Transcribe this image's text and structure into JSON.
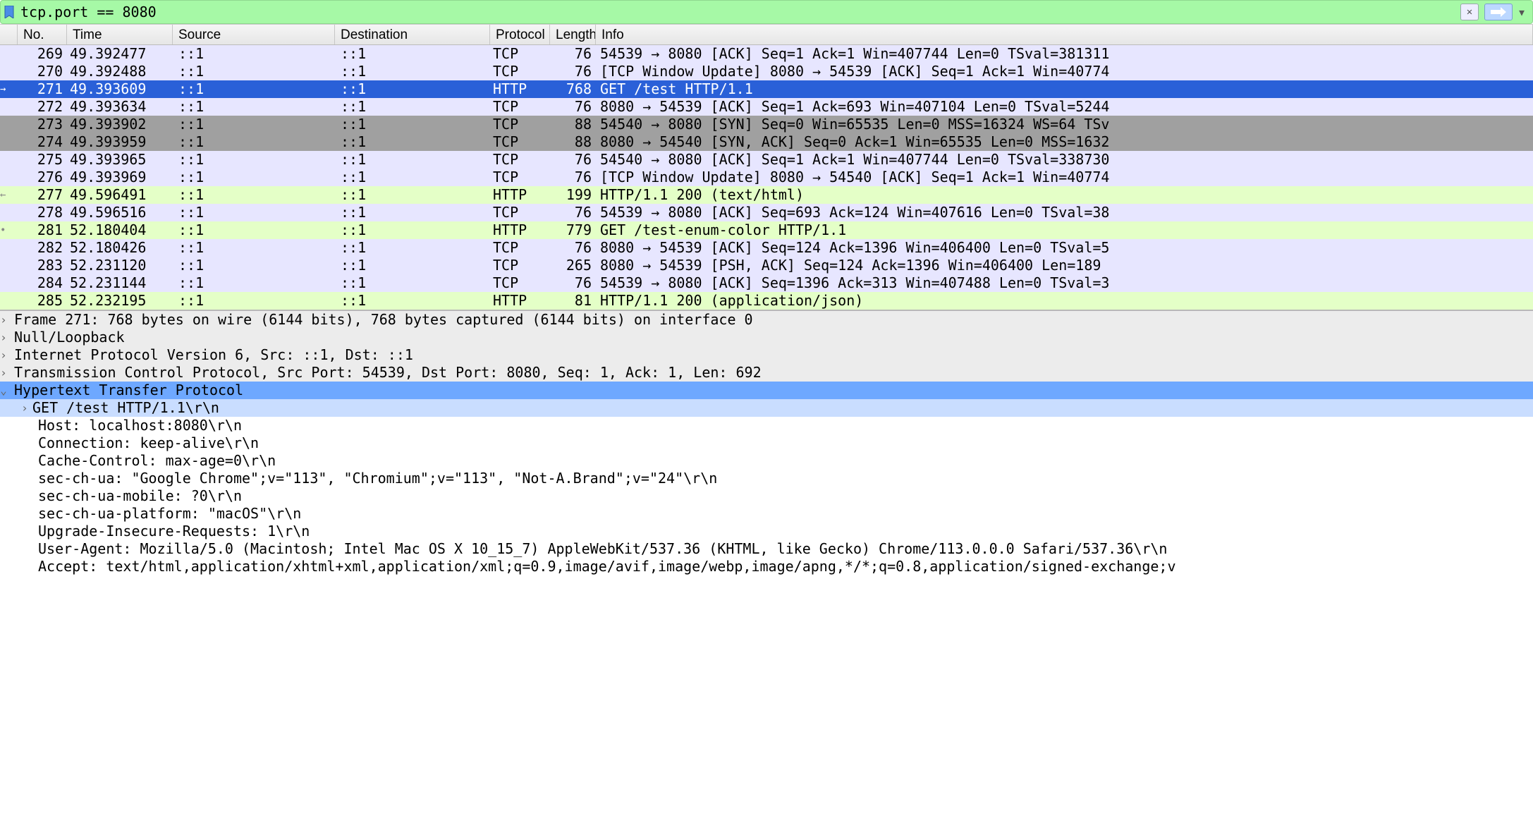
{
  "filter": {
    "value": "tcp.port == 8080"
  },
  "columns": {
    "no": "No.",
    "time": "Time",
    "source": "Source",
    "destination": "Destination",
    "protocol": "Protocol",
    "length": "Length",
    "info": "Info"
  },
  "packets": [
    {
      "no": 269,
      "time": "49.392477",
      "src": "::1",
      "dst": "::1",
      "proto": "TCP",
      "len": 76,
      "info": "54539 → 8080 [ACK] Seq=1 Ack=1 Win=407744 Len=0 TSval=381311",
      "cls": "row-lav"
    },
    {
      "no": 270,
      "time": "49.392488",
      "src": "::1",
      "dst": "::1",
      "proto": "TCP",
      "len": 76,
      "info": "[TCP Window Update] 8080 → 54539 [ACK] Seq=1 Ack=1 Win=40774",
      "cls": "row-lav"
    },
    {
      "no": 271,
      "time": "49.393609",
      "src": "::1",
      "dst": "::1",
      "proto": "HTTP",
      "len": 768,
      "info": "GET /test HTTP/1.1",
      "cls": "row-sel",
      "gutter": "→"
    },
    {
      "no": 272,
      "time": "49.393634",
      "src": "::1",
      "dst": "::1",
      "proto": "TCP",
      "len": 76,
      "info": "8080 → 54539 [ACK] Seq=1 Ack=693 Win=407104 Len=0 TSval=5244",
      "cls": "row-lav"
    },
    {
      "no": 273,
      "time": "49.393902",
      "src": "::1",
      "dst": "::1",
      "proto": "TCP",
      "len": 88,
      "info": "54540 → 8080 [SYN] Seq=0 Win=65535 Len=0 MSS=16324 WS=64 TSv",
      "cls": "row-gray"
    },
    {
      "no": 274,
      "time": "49.393959",
      "src": "::1",
      "dst": "::1",
      "proto": "TCP",
      "len": 88,
      "info": "8080 → 54540 [SYN, ACK] Seq=0 Ack=1 Win=65535 Len=0 MSS=1632",
      "cls": "row-gray"
    },
    {
      "no": 275,
      "time": "49.393965",
      "src": "::1",
      "dst": "::1",
      "proto": "TCP",
      "len": 76,
      "info": "54540 → 8080 [ACK] Seq=1 Ack=1 Win=407744 Len=0 TSval=338730",
      "cls": "row-lav"
    },
    {
      "no": 276,
      "time": "49.393969",
      "src": "::1",
      "dst": "::1",
      "proto": "TCP",
      "len": 76,
      "info": "[TCP Window Update] 8080 → 54540 [ACK] Seq=1 Ack=1 Win=40774",
      "cls": "row-lav"
    },
    {
      "no": 277,
      "time": "49.596491",
      "src": "::1",
      "dst": "::1",
      "proto": "HTTP",
      "len": 199,
      "info": "HTTP/1.1 200   (text/html)",
      "cls": "row-green",
      "gutter": "←"
    },
    {
      "no": 278,
      "time": "49.596516",
      "src": "::1",
      "dst": "::1",
      "proto": "TCP",
      "len": 76,
      "info": "54539 → 8080 [ACK] Seq=693 Ack=124 Win=407616 Len=0 TSval=38",
      "cls": "row-lav"
    },
    {
      "no": 281,
      "time": "52.180404",
      "src": "::1",
      "dst": "::1",
      "proto": "HTTP",
      "len": 779,
      "info": "GET /test-enum-color HTTP/1.1",
      "cls": "row-green",
      "gutter": "•"
    },
    {
      "no": 282,
      "time": "52.180426",
      "src": "::1",
      "dst": "::1",
      "proto": "TCP",
      "len": 76,
      "info": "8080 → 54539 [ACK] Seq=124 Ack=1396 Win=406400 Len=0 TSval=5",
      "cls": "row-lav"
    },
    {
      "no": 283,
      "time": "52.231120",
      "src": "::1",
      "dst": "::1",
      "proto": "TCP",
      "len": 265,
      "info": "8080 → 54539 [PSH, ACK] Seq=124 Ack=1396 Win=406400 Len=189 ",
      "cls": "row-lav"
    },
    {
      "no": 284,
      "time": "52.231144",
      "src": "::1",
      "dst": "::1",
      "proto": "TCP",
      "len": 76,
      "info": "54539 → 8080 [ACK] Seq=1396 Ack=313 Win=407488 Len=0 TSval=3",
      "cls": "row-lav"
    },
    {
      "no": 285,
      "time": "52.232195",
      "src": "::1",
      "dst": "::1",
      "proto": "HTTP",
      "len": 81,
      "info": "HTTP/1.1 200   (application/json)",
      "cls": "row-green"
    }
  ],
  "detail": {
    "frame": "Frame 271: 768 bytes on wire (6144 bits), 768 bytes captured (6144 bits) on interface 0",
    "null": "Null/Loopback",
    "ip": "Internet Protocol Version 6, Src: ::1, Dst: ::1",
    "tcp": "Transmission Control Protocol, Src Port: 54539, Dst Port: 8080, Seq: 1, Ack: 1, Len: 692",
    "http": "Hypertext Transfer Protocol",
    "get": "GET /test HTTP/1.1\\r\\n",
    "hdrs": [
      "Host: localhost:8080\\r\\n",
      "Connection: keep-alive\\r\\n",
      "Cache-Control: max-age=0\\r\\n",
      "sec-ch-ua: \"Google Chrome\";v=\"113\", \"Chromium\";v=\"113\", \"Not-A.Brand\";v=\"24\"\\r\\n",
      "sec-ch-ua-mobile: ?0\\r\\n",
      "sec-ch-ua-platform: \"macOS\"\\r\\n",
      "Upgrade-Insecure-Requests: 1\\r\\n",
      "User-Agent: Mozilla/5.0 (Macintosh; Intel Mac OS X 10_15_7) AppleWebKit/537.36 (KHTML, like Gecko) Chrome/113.0.0.0 Safari/537.36\\r\\n",
      "Accept: text/html,application/xhtml+xml,application/xml;q=0.9,image/avif,image/webp,image/apng,*/*;q=0.8,application/signed-exchange;v"
    ]
  },
  "glyph": {
    "tri_right": "›",
    "tri_down": "⌄"
  }
}
